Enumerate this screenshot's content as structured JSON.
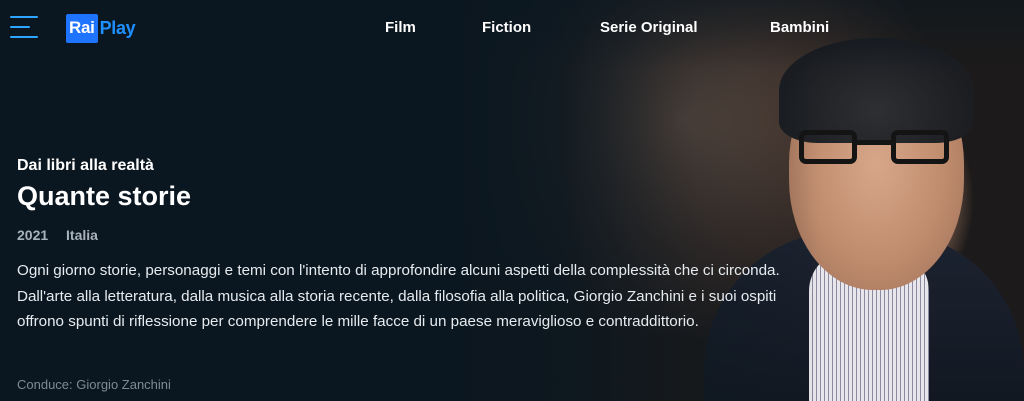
{
  "header": {
    "logo": {
      "rai": "Rai",
      "play": "Play"
    },
    "nav": [
      {
        "label": "Film"
      },
      {
        "label": "Fiction"
      },
      {
        "label": "Serie Original"
      },
      {
        "label": "Bambini"
      }
    ]
  },
  "program": {
    "subtitle": "Dai libri alla realtà",
    "title": "Quante storie",
    "year": "2021",
    "country": "Italia",
    "description": "Ogni giorno storie, personaggi e temi con l'intento di approfondire alcuni aspetti della complessità che ci circonda. Dall'arte alla letteratura, dalla musica alla storia recente, dalla filosofia alla politica, Giorgio Zanchini e i suoi ospiti offrono spunti di riflessione per comprendere le mille facce di un paese meraviglioso e contraddittorio.",
    "host": "Conduce: Giorgio Zanchini"
  },
  "colors": {
    "background": "#0b1720",
    "accent": "#2ea6ff",
    "logo_blue": "#1e73ff"
  },
  "icons": {
    "menu": "hamburger-menu-icon"
  }
}
